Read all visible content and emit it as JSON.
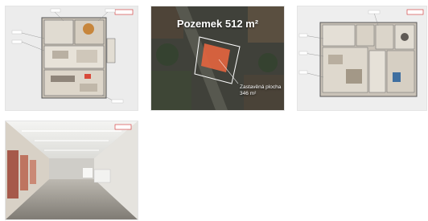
{
  "gallery": {
    "images": [
      {
        "alt": "Floor plan 1"
      },
      {
        "alt": "Aerial view",
        "title": "Pozemek 512 m²",
        "label_line1": "Zastavěná plocha",
        "label_line2": "346 m²"
      },
      {
        "alt": "Floor plan 2"
      },
      {
        "alt": "Interior hall"
      }
    ]
  },
  "colors": {
    "accent": "#d12c2c"
  }
}
